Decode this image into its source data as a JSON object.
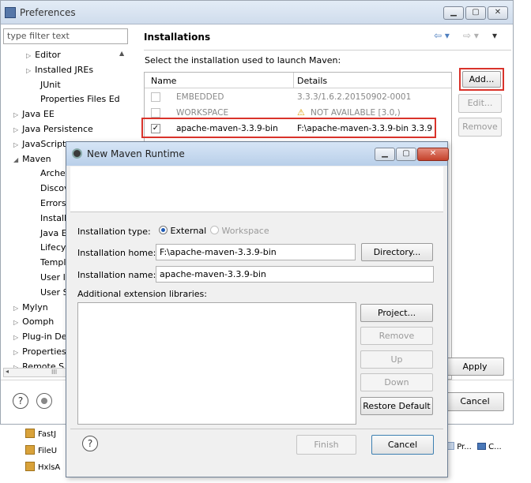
{
  "preferences": {
    "title": "Preferences",
    "filter_placeholder": "type filter text",
    "tree": [
      {
        "label": "Editor",
        "expander": "▷"
      },
      {
        "label": "Installed JREs",
        "expander": "▷"
      },
      {
        "label": "JUnit",
        "expander": ""
      },
      {
        "label": "Properties Files Ed",
        "expander": ""
      },
      {
        "label": "Java EE",
        "expander": "▷"
      },
      {
        "label": "Java Persistence",
        "expander": "▷"
      },
      {
        "label": "JavaScript",
        "expander": "▷"
      },
      {
        "label": "Maven",
        "expander": "◢"
      },
      {
        "label": "Archet",
        "expander": ""
      },
      {
        "label": "Discov",
        "expander": ""
      },
      {
        "label": "Errors/",
        "expander": ""
      },
      {
        "label": "Installa",
        "expander": ""
      },
      {
        "label": "Java EE",
        "expander": ""
      },
      {
        "label": "Lifecyc",
        "expander": ""
      },
      {
        "label": "Templa",
        "expander": ""
      },
      {
        "label": "User In",
        "expander": ""
      },
      {
        "label": "User S",
        "expander": ""
      },
      {
        "label": "Mylyn",
        "expander": "▷"
      },
      {
        "label": "Oomph",
        "expander": "▷"
      },
      {
        "label": "Plug-in De",
        "expander": "▷"
      },
      {
        "label": "Properties",
        "expander": "▷"
      },
      {
        "label": "Remote S",
        "expander": "▷"
      }
    ],
    "section_title": "Installations",
    "instruction": "Select the installation used to launch Maven:",
    "columns": {
      "name": "Name",
      "details": "Details"
    },
    "rows": [
      {
        "name": "EMBEDDED",
        "details": "3.3.3/1.6.2.20150902-0001",
        "checked": "",
        "warn": "",
        "disabled": true
      },
      {
        "name": "WORKSPACE",
        "details": "NOT AVAILABLE [3.0,)",
        "checked": "",
        "warn": "⚠",
        "disabled": true
      },
      {
        "name": "apache-maven-3.3.9-bin",
        "details": "F:\\apache-maven-3.3.9-bin 3.3.9",
        "checked": "✓",
        "warn": "",
        "disabled": false
      }
    ],
    "buttons": {
      "add": "Add...",
      "edit": "Edit...",
      "remove": "Remove",
      "apply": "Apply",
      "cancel": "Cancel"
    },
    "nav": {
      "back": "⇦ ▾",
      "forward": "⇨ ▾",
      "menu": "▾"
    },
    "help": "?",
    "scroll_dots": "III"
  },
  "dialog": {
    "title": "New Maven Runtime",
    "type_label": "Installation type:",
    "type_external": "External",
    "type_workspace": "Workspace",
    "home_label": "Installation home:",
    "home_value": "F:\\apache-maven-3.3.9-bin",
    "directory_button": "Directory...",
    "name_label": "Installation name:",
    "name_value": "apache-maven-3.3.9-bin",
    "libraries_label": "Additional extension libraries:",
    "project_button": "Project...",
    "remove_button": "Remove",
    "up_button": "Up",
    "down_button": "Down",
    "restore_button": "Restore Default",
    "finish_button": "Finish",
    "cancel_button": "Cancel",
    "help": "?"
  },
  "background": {
    "tree": [
      "FastJ",
      "FileU",
      "HxlsA"
    ],
    "status_items": [
      "Pr...",
      "C..."
    ]
  },
  "colors": {
    "highlight_red": "#d9332b",
    "radio_blue": "#1e5bb5"
  }
}
